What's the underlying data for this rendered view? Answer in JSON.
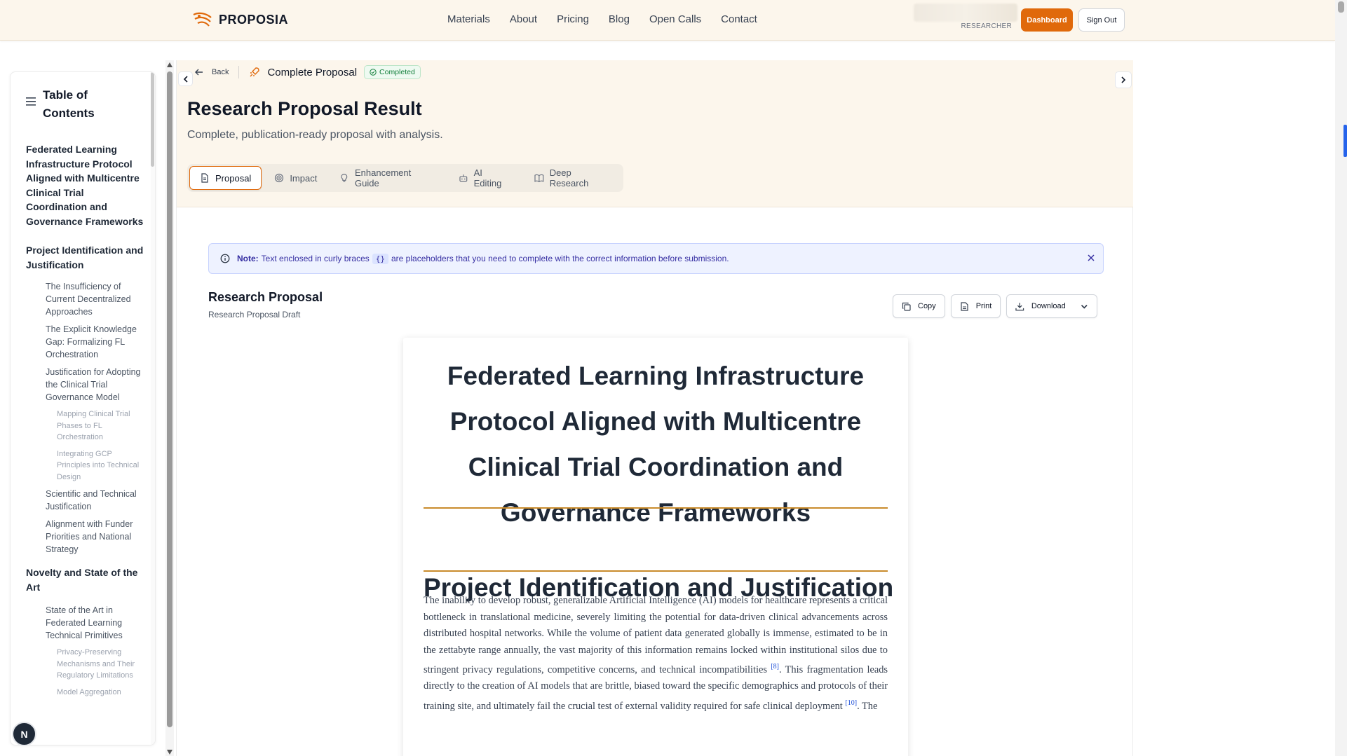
{
  "brand": {
    "name": "PROPOSIA"
  },
  "nav": [
    "Materials",
    "About",
    "Pricing",
    "Blog",
    "Open Calls",
    "Contact"
  ],
  "user": {
    "role": "RESEARCHER",
    "dashboard_label": "Dashboard",
    "signout_label": "Sign Out"
  },
  "toc": {
    "title": "Table of Contents",
    "items": [
      {
        "level": 1,
        "text": "Federated Learning Infrastructure Protocol Aligned with Multicentre Clinical Trial Coordination and Governance Frameworks"
      },
      {
        "level": 1,
        "text": "Project Identification and Justification"
      },
      {
        "level": 2,
        "text": "The Insufficiency of Current Decentralized Approaches"
      },
      {
        "level": 2,
        "text": "The Explicit Knowledge Gap: Formalizing FL Orchestration"
      },
      {
        "level": 2,
        "text": "Justification for Adopting the Clinical Trial Governance Model"
      },
      {
        "level": 3,
        "text": "Mapping Clinical Trial Phases to FL Orchestration"
      },
      {
        "level": 3,
        "text": "Integrating GCP Principles into Technical Design"
      },
      {
        "level": 2,
        "text": "Scientific and Technical Justification"
      },
      {
        "level": 2,
        "text": "Alignment with Funder Priorities and National Strategy"
      },
      {
        "level": 1,
        "text": "Novelty and State of the Art"
      },
      {
        "level": 2,
        "text": "State of the Art in Federated Learning Technical Primitives"
      },
      {
        "level": 3,
        "text": "Privacy-Preserving Mechanisms and Their Regulatory Limitations"
      },
      {
        "level": 3,
        "text": "Model Aggregation"
      }
    ]
  },
  "floating_avatar": "N",
  "header": {
    "back_label": "Back",
    "breadcrumb_title": "Complete Proposal",
    "status": "Completed",
    "title": "Research Proposal Result",
    "subtitle": "Complete, publication-ready proposal with analysis."
  },
  "tabs": [
    {
      "label": "Proposal",
      "icon": "document-icon",
      "active": true
    },
    {
      "label": "Impact",
      "icon": "target-icon",
      "active": false
    },
    {
      "label": "Enhancement Guide",
      "icon": "lightbulb-icon",
      "active": false
    },
    {
      "label": "AI Editing",
      "icon": "robot-icon",
      "active": false
    },
    {
      "label": "Deep Research",
      "icon": "book-icon",
      "active": false
    }
  ],
  "note": {
    "label": "Note:",
    "before": "Text enclosed in curly braces",
    "braces": "{}",
    "after": "are placeholders that you need to complete with the correct information before submission."
  },
  "doc": {
    "title": "Research Proposal",
    "subtitle": "Research Proposal Draft",
    "actions": {
      "copy": "Copy",
      "print": "Print",
      "download": "Download"
    }
  },
  "paper": {
    "title": "Federated Learning Infrastructure Protocol Aligned with Multicentre Clinical Trial Coordination and Governance Frameworks",
    "section": "Project Identification and Justification",
    "para_part1": "The inability to develop robust, generalizable Artificial Intelligence (AI) models for healthcare represents a critical bottleneck in translational medicine, severely limiting the potential for data-driven clinical advancements across distributed hospital networks. While the volume of patient data generated globally is immense, estimated to be in the zettabyte range annually, the vast majority of this information remains locked within institutional silos due to stringent privacy regulations, competitive concerns, and technical incompatibilities",
    "cite1": "[8]",
    "para_part2": ". This fragmentation leads directly to the creation of AI models that are brittle, biased toward the specific demographics and protocols of their training site, and ultimately fail the crucial test of external validity required for safe clinical deployment",
    "cite2": "[10]",
    "para_part3": ". The"
  },
  "colors": {
    "accent": "#e0690b",
    "header_bg": "#fcf6ec",
    "rule": "#c98b2c",
    "note_bg": "#eef2ff",
    "success": "#15803d"
  }
}
